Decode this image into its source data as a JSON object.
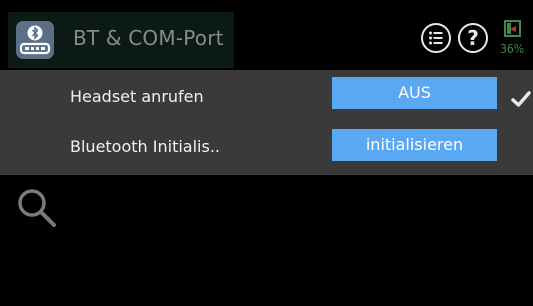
{
  "header": {
    "title": "BT & COM-Port",
    "app_icon": "bluetooth-com-icon",
    "buttons": [
      {
        "name": "menu-list-icon"
      },
      {
        "name": "help-question-icon"
      }
    ],
    "battery": {
      "percent_label": "36%",
      "level": 0.36
    }
  },
  "rows": [
    {
      "label": "Headset anrufen",
      "value": "AUS",
      "selected": true
    },
    {
      "label": "Bluetooth Initialis..",
      "value": "initialisieren",
      "selected": false
    }
  ],
  "search": {
    "icon": "search-icon"
  },
  "colors": {
    "accent": "#5aa7f4",
    "panel": "#3a3a3a",
    "title_block": "#0b1a12",
    "battery": "#3f8a4a"
  }
}
